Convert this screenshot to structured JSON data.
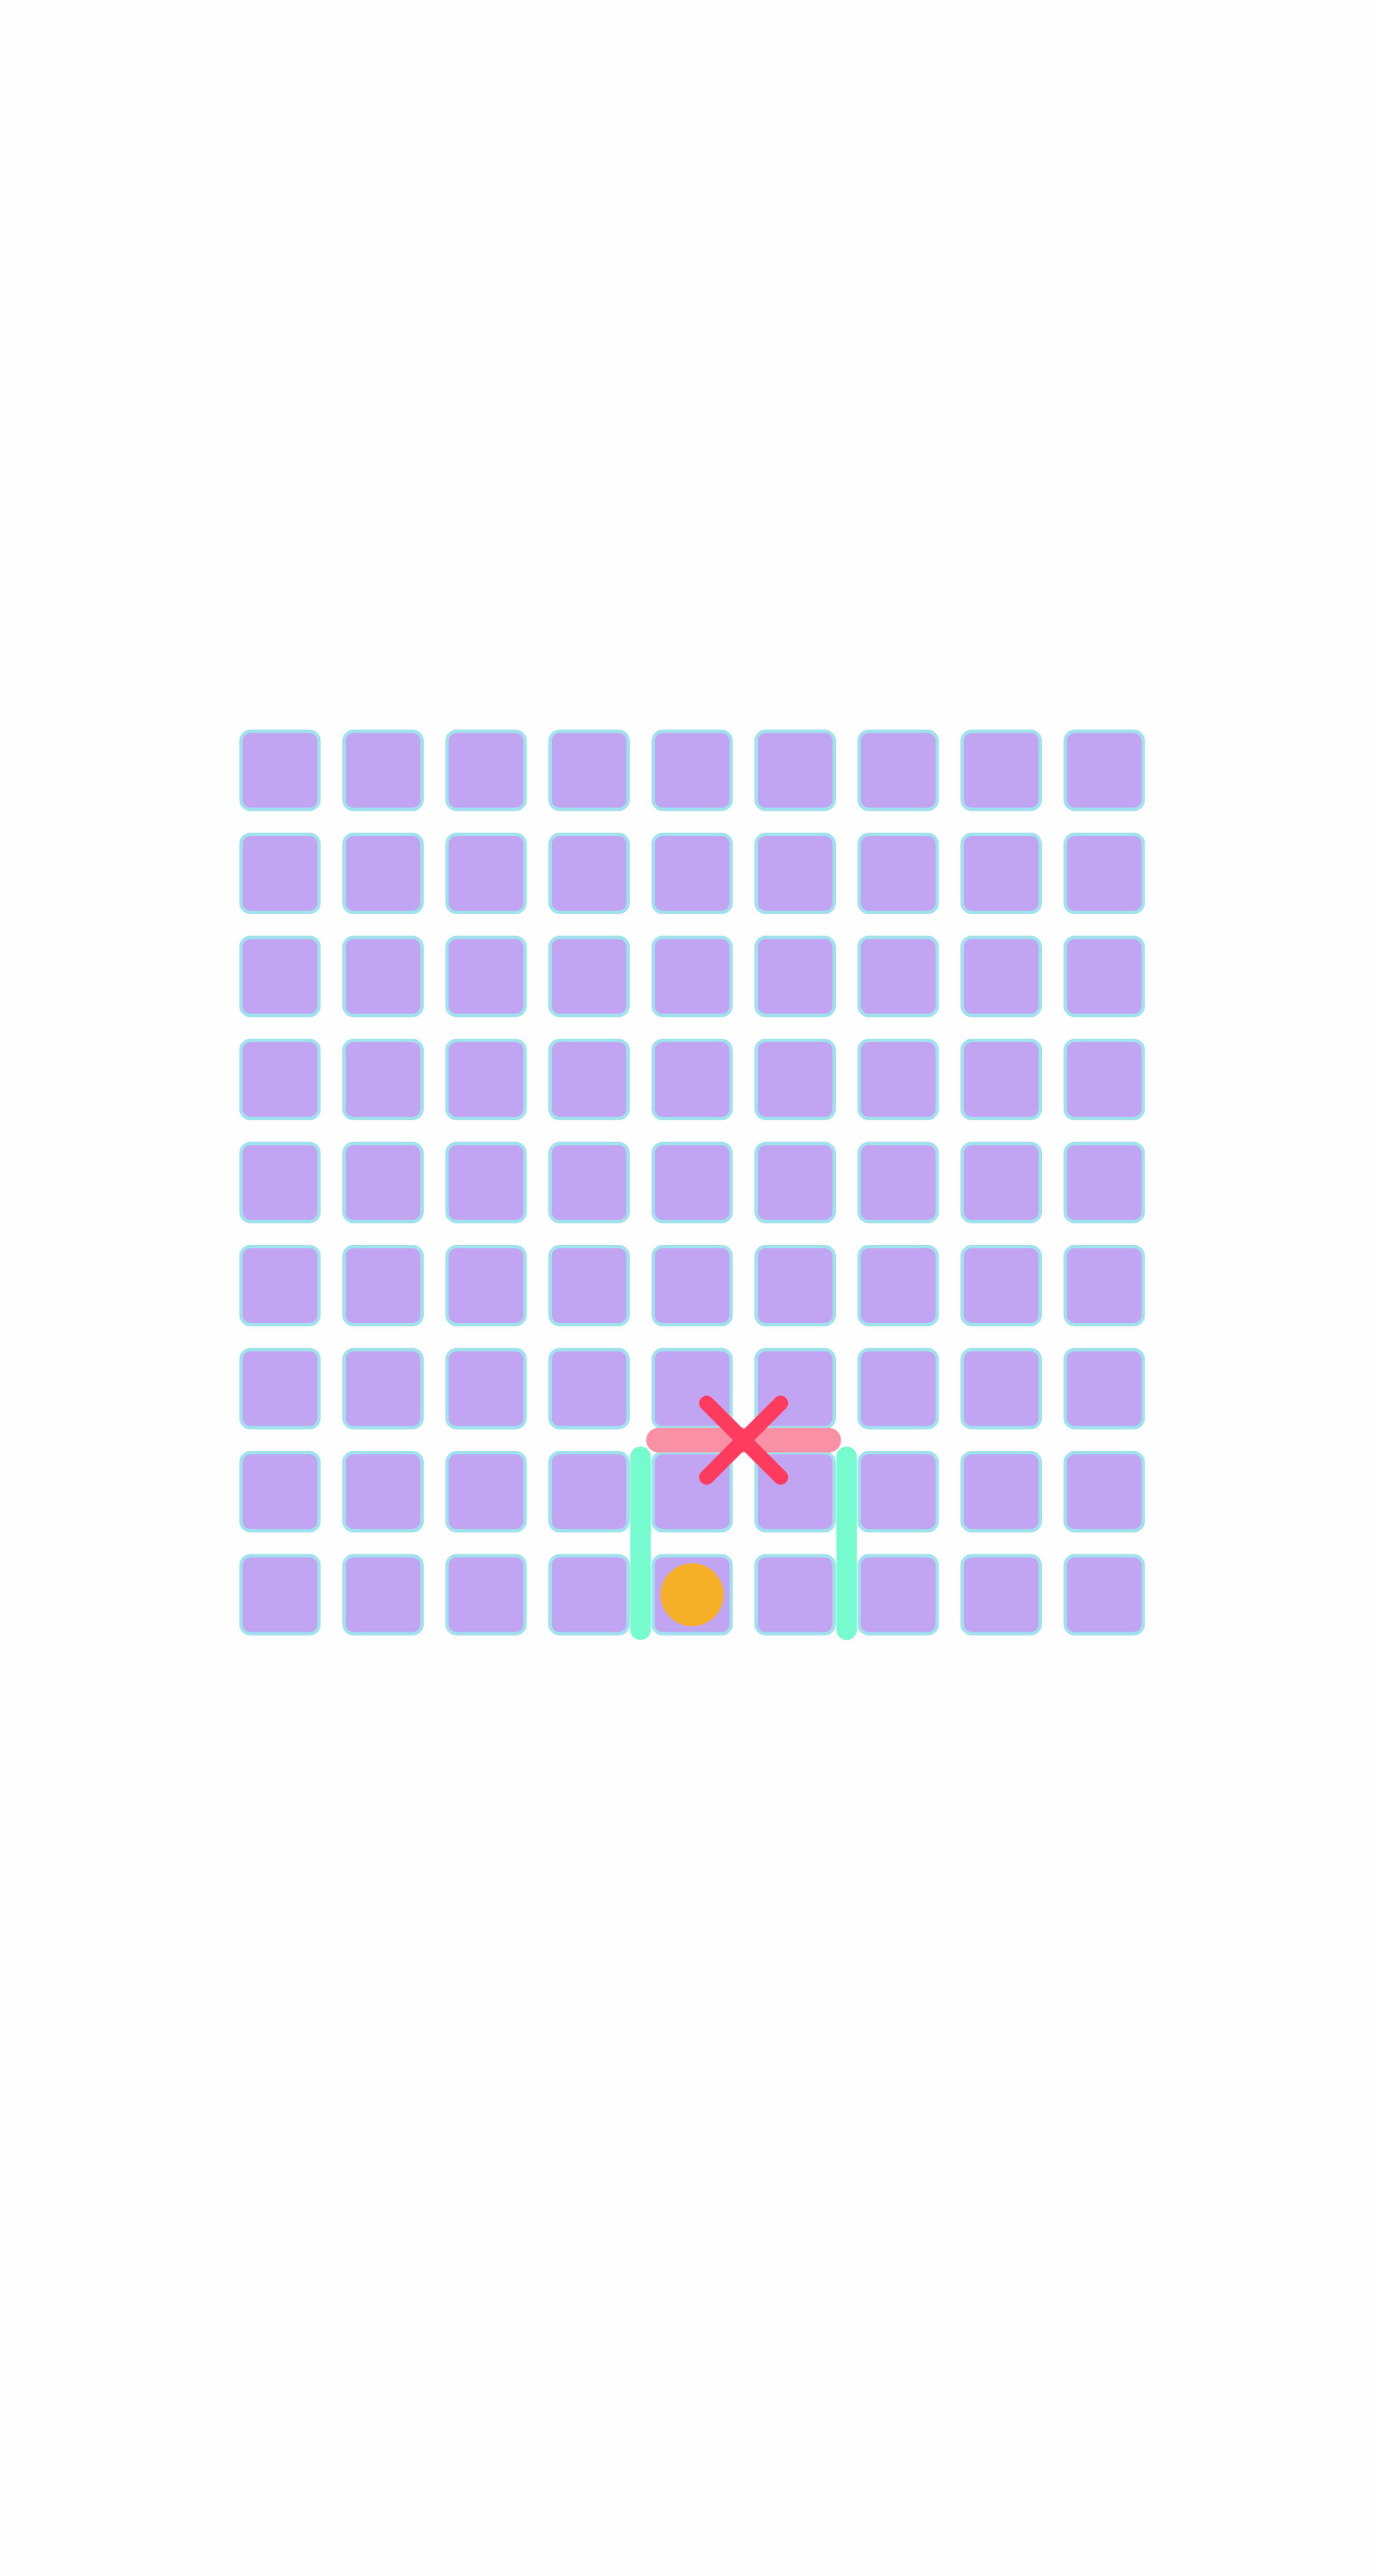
{
  "game": {
    "board": {
      "rows": 9,
      "cols": 9,
      "cell_fill": "#c1a4f2",
      "cell_stroke": "#9fe2ee"
    },
    "player": {
      "row": 8,
      "col": 4,
      "color": "#f5b027"
    },
    "goal_marker": {
      "shape": "x",
      "between_row": 6,
      "between_row_next": 7,
      "between_col": 4,
      "between_col_next": 5,
      "color": "#ff3b5e"
    },
    "walls": [
      {
        "orientation": "horizontal",
        "row_boundary": 7,
        "col_start": 4,
        "col_end": 6,
        "color": "#f990a6"
      },
      {
        "orientation": "vertical",
        "col_boundary": 4,
        "row_start": 7,
        "row_end": 9,
        "color": "#76fbcf"
      },
      {
        "orientation": "vertical",
        "col_boundary": 6,
        "row_start": 7,
        "row_end": 9,
        "color": "#76fbcf"
      }
    ]
  }
}
